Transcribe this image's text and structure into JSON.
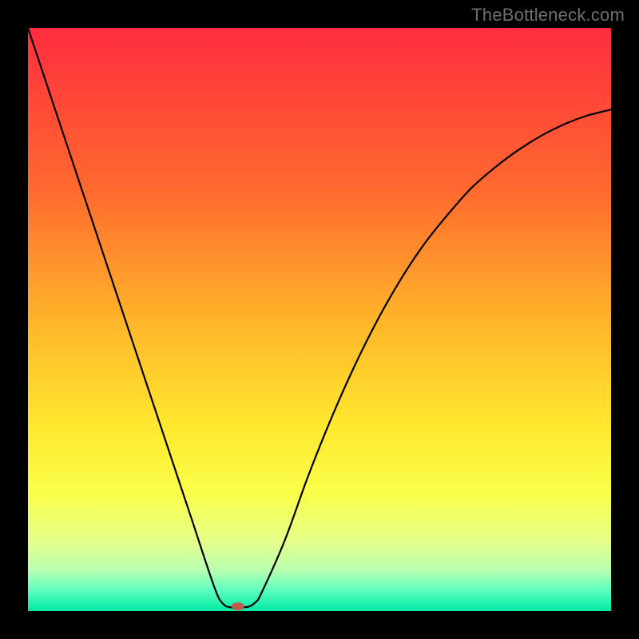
{
  "watermark": {
    "text": "TheBottleneck.com"
  },
  "chart_data": {
    "type": "line",
    "title": "",
    "xlabel": "",
    "ylabel": "",
    "xlim": [
      0,
      100
    ],
    "ylim": [
      0,
      100
    ],
    "background_gradient": {
      "stops": [
        {
          "offset": 0.0,
          "color": "#ff2d3f"
        },
        {
          "offset": 0.28,
          "color": "#ff6a2f"
        },
        {
          "offset": 0.5,
          "color": "#ffb42a"
        },
        {
          "offset": 0.68,
          "color": "#ffe72e"
        },
        {
          "offset": 0.8,
          "color": "#f9ff4a"
        },
        {
          "offset": 0.88,
          "color": "#e5ff8a"
        },
        {
          "offset": 0.93,
          "color": "#b8ffb0"
        },
        {
          "offset": 0.965,
          "color": "#5cffc0"
        },
        {
          "offset": 1.0,
          "color": "#00e9a3"
        }
      ]
    },
    "series": [
      {
        "name": "bottleneck-curve",
        "color": "#000000",
        "stroke_width": 2.2,
        "x": [
          0,
          4,
          8,
          12,
          16,
          20,
          24,
          28,
          32,
          33.5,
          35,
          36.5,
          38,
          39,
          40,
          44,
          48,
          52,
          56,
          60,
          64,
          68,
          72,
          76,
          80,
          84,
          88,
          92,
          96,
          100
        ],
        "y": [
          100,
          88,
          76,
          64,
          52,
          40,
          28,
          16,
          4,
          1.2,
          0.6,
          0.6,
          0.8,
          1.5,
          3,
          12,
          23,
          33,
          42,
          50,
          57,
          63,
          68,
          72.5,
          76,
          79,
          81.5,
          83.5,
          85,
          86
        ]
      }
    ],
    "marker": {
      "name": "optimal-point",
      "x": 36,
      "y": 0.8,
      "rx": 8,
      "ry": 5,
      "color": "#c15a4f"
    }
  }
}
